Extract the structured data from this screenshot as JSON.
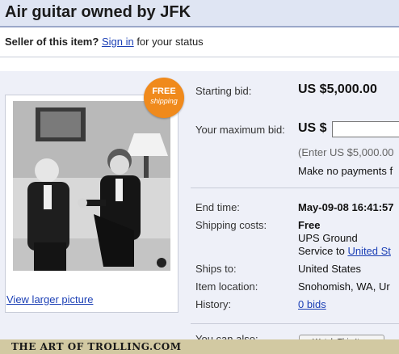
{
  "page": {
    "title": "Air guitar owned by JFK"
  },
  "seller": {
    "prefix": "Seller of this item?",
    "sign_in": "Sign in",
    "suffix": "for your status"
  },
  "badge": {
    "line1": "FREE",
    "line2": "shipping"
  },
  "photo": {
    "view_larger": "View larger picture"
  },
  "details": {
    "starting_bid_label": "Starting bid:",
    "starting_bid_value": "US $5,000.00",
    "max_bid_label": "Your maximum bid:",
    "max_bid_currency": "US $",
    "max_bid_input": "",
    "enter_hint": "(Enter US $5,000.00",
    "no_payments": "Make no payments f",
    "end_time_label": "End time:",
    "end_time_value": "May-09-08 16:41:57",
    "shipping_label": "Shipping costs:",
    "shipping_value": "Free",
    "shipping_method": "UPS Ground",
    "service_to_prefix": "Service to",
    "service_to_link": "United St",
    "ships_to_label": "Ships to:",
    "ships_to_value": "United States",
    "location_label": "Item location:",
    "location_value": "Snohomish, WA, Ur",
    "history_label": "History:",
    "history_value": "0 bids",
    "also_label": "You can also:",
    "watch_button": "Watch This Item"
  },
  "footer": {
    "watermark": "THE ART OF TROLLING.COM"
  },
  "colors": {
    "title_bar": "#dfe5f3",
    "link": "#1b3fb5",
    "badge": "#f08a1c",
    "content_bg": "#eef0f8",
    "stripe": "#d2c9a2"
  },
  "icons": [
    "free-shipping-badge",
    "flag-icon"
  ]
}
